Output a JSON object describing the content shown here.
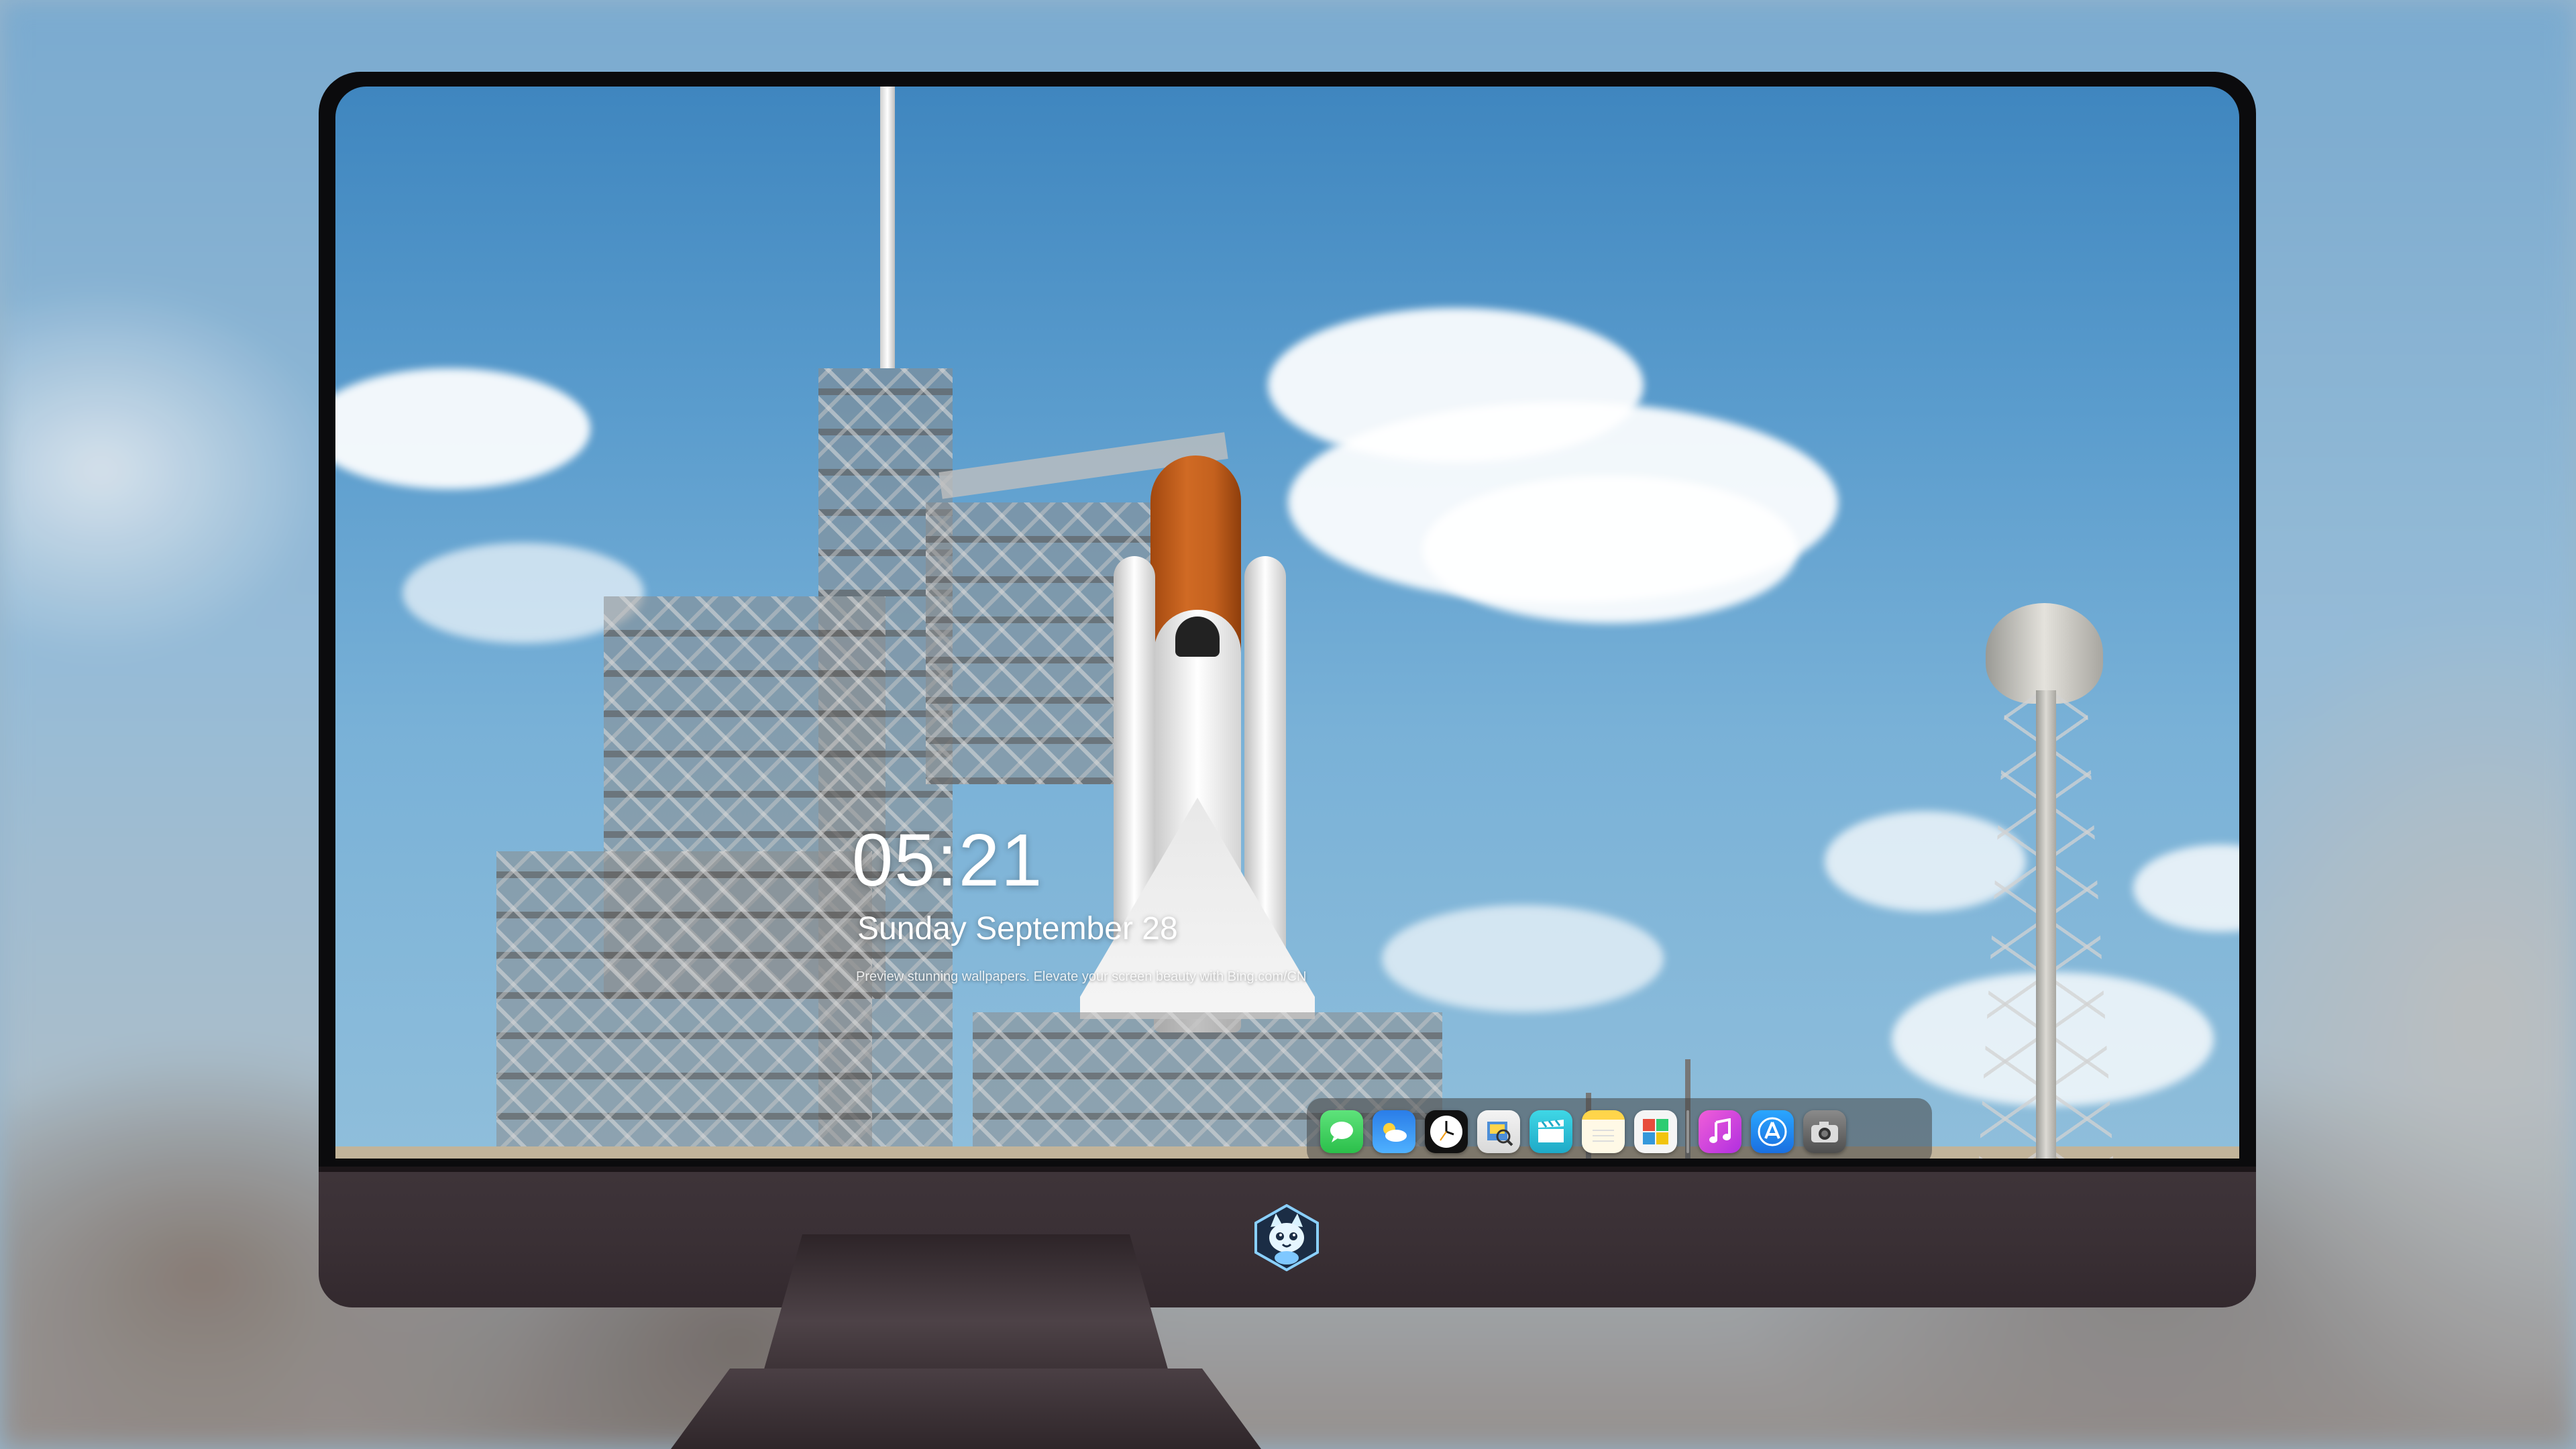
{
  "lockscreen": {
    "time": "05:21",
    "date": "Sunday September  28",
    "tagline": "Preview stunning wallpapers. Elevate your screen beauty with Bing.com/CN"
  },
  "dock": {
    "apps": [
      {
        "name": "Messages",
        "icon": "messages-icon",
        "color": "#35c759"
      },
      {
        "name": "Weather",
        "icon": "weather-icon",
        "color": "#2f8df5"
      },
      {
        "name": "Clock",
        "icon": "clock-icon",
        "color": "#111111"
      },
      {
        "name": "Preview",
        "icon": "preview-icon",
        "color": "#4c8ed8"
      },
      {
        "name": "Clips",
        "icon": "clips-icon",
        "color": "#2bc8d9"
      },
      {
        "name": "Notes",
        "icon": "notes-icon",
        "color": "#ffd54a"
      },
      {
        "name": "Photo Booth",
        "icon": "photo-booth-icon",
        "color": "#6ab04c"
      },
      {
        "name": "Music",
        "icon": "music-icon",
        "color": "#d63ad9"
      },
      {
        "name": "App Store",
        "icon": "app-store-icon",
        "color": "#1e90ff"
      },
      {
        "name": "Camera",
        "icon": "camera-icon",
        "color": "#6a6a6a"
      }
    ]
  },
  "monitor": {
    "logo": "cat-mascot-logo"
  },
  "wallpaper": {
    "subject": "space-shuttle-launch-pad-wallpaper"
  }
}
